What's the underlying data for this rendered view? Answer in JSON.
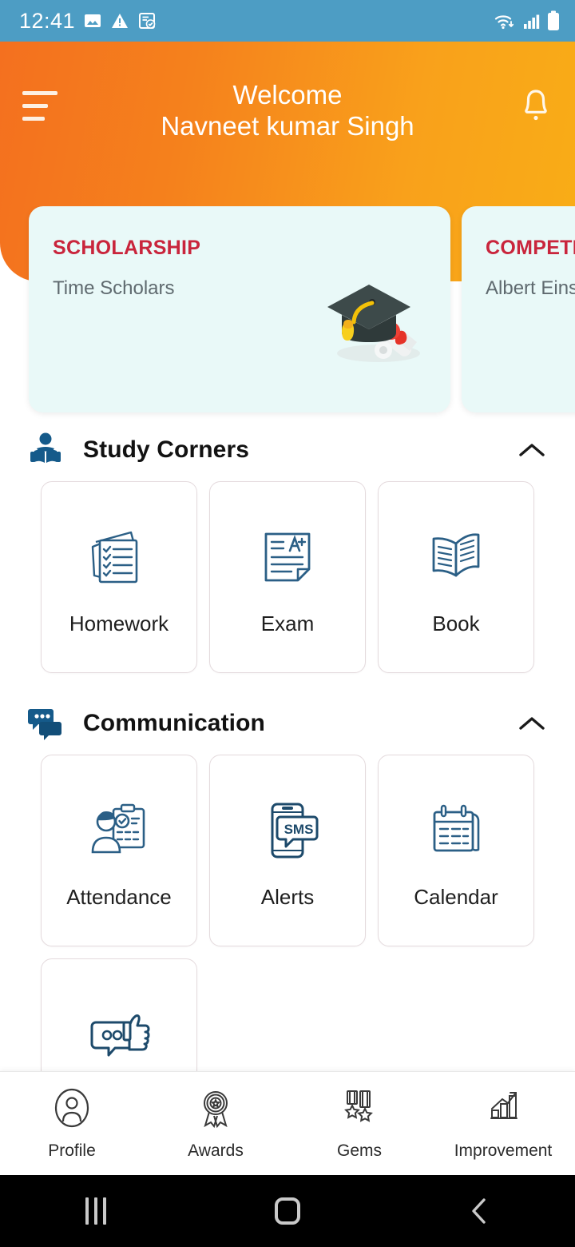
{
  "status_bar": {
    "time": "12:41",
    "left_icons": [
      "image-icon",
      "warning-icon",
      "document-check-icon"
    ],
    "right_icons": [
      "wifi-icon",
      "cellular-signal-icon",
      "battery-icon"
    ],
    "background_color": "#4d9dc4"
  },
  "header": {
    "menu_icon": "hamburger-menu-icon",
    "greeting": "Welcome",
    "user_name": "Navneet kumar Singh",
    "notification_icon": "bell-icon",
    "gradient_from": "#f4701f",
    "gradient_to": "#f9ad16"
  },
  "carousel": {
    "cards": [
      {
        "title": "SCHOLARSHIP",
        "subtitle": "Time Scholars",
        "art": "graduation-cap-diploma-illustration",
        "title_color": "#c9253c",
        "background_color": "#e9f9f8"
      },
      {
        "title": "COMPETITION",
        "subtitle": "Albert Einstein Scholarship",
        "art": "",
        "title_color": "#c9253c",
        "background_color": "#e9f9f8"
      }
    ]
  },
  "sections": [
    {
      "title": "Study Corners",
      "icon": "person-reading-book-icon",
      "collapse_icon": "chevron-up-icon",
      "tiles": [
        {
          "label": "Homework",
          "icon": "checklist-papers-icon"
        },
        {
          "label": "Exam",
          "icon": "exam-paper-a-plus-icon"
        },
        {
          "label": "Book",
          "icon": "open-book-icon"
        }
      ]
    },
    {
      "title": "Communication",
      "icon": "chat-bubbles-icon",
      "collapse_icon": "chevron-up-icon",
      "tiles": [
        {
          "label": "Attendance",
          "icon": "person-clipboard-check-icon"
        },
        {
          "label": "Alerts",
          "icon": "phone-sms-icon"
        },
        {
          "label": "Calendar",
          "icon": "desk-calendar-icon"
        },
        {
          "label": "",
          "icon": "thumbs-up-feedback-icon"
        }
      ]
    }
  ],
  "bottom_tabs": [
    {
      "label": "Profile",
      "icon": "person-circle-icon"
    },
    {
      "label": "Awards",
      "icon": "award-rosette-icon"
    },
    {
      "label": "Gems",
      "icon": "medals-icon"
    },
    {
      "label": "Improvement",
      "icon": "bar-chart-arrow-icon"
    }
  ],
  "android_nav": {
    "recents": "recents-icon",
    "home": "home-icon",
    "back": "back-icon"
  }
}
